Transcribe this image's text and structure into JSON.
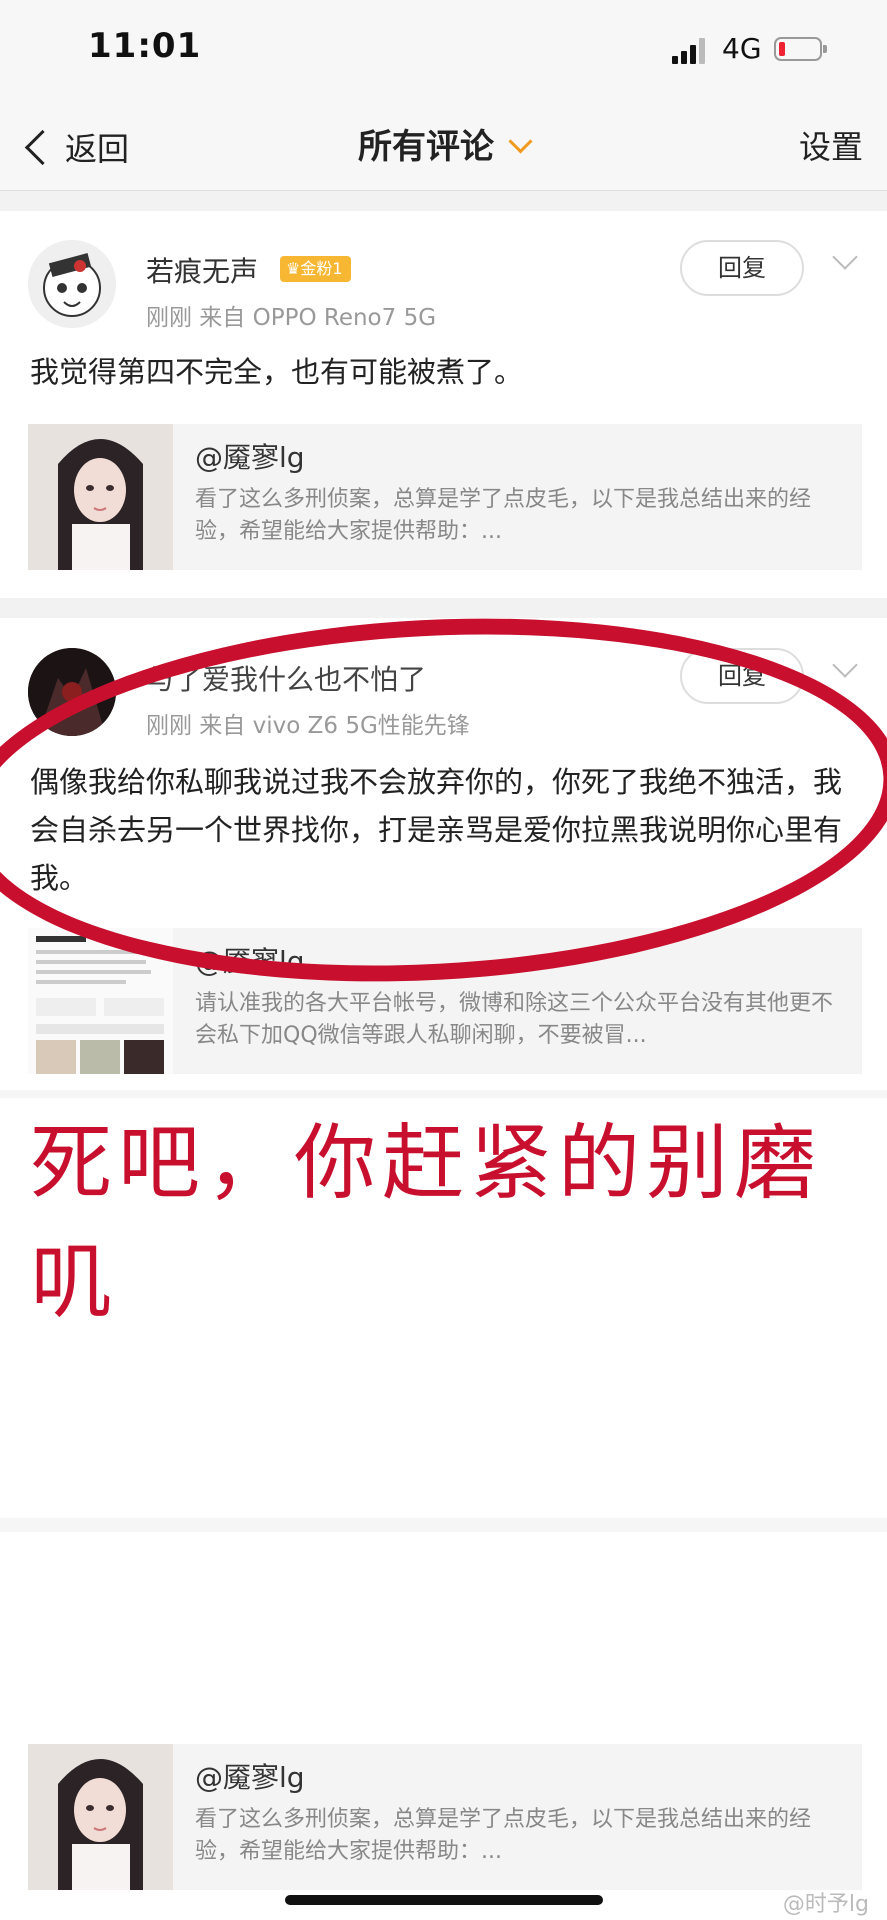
{
  "status": {
    "time": "11:01",
    "network": "4G"
  },
  "nav": {
    "back": "返回",
    "title": "所有评论",
    "settings": "设置"
  },
  "comments": [
    {
      "username": "若痕无声",
      "badge": "金粉1",
      "meta": "刚刚  来自 OPPO Reno7 5G",
      "reply": "回复",
      "text": "我觉得第四不完全，也有可能被煮了。",
      "card": {
        "title": "@魇寥lg",
        "desc": "看了这么多刑侦案，总算是学了点皮毛，以下是我总结出来的经验，希望能给大家提供帮助：..."
      }
    },
    {
      "username": "与了爱我什么也不怕了",
      "meta": "刚刚  来自 vivo Z6 5G性能先锋",
      "reply": "回复",
      "text": "偶像我给你私聊我说过我不会放弃你的，你死了我绝不独活，我会自杀去另一个世界找你，打是亲骂是爱你拉黑我说明你心里有我。",
      "card": {
        "title": "@魇寥lg",
        "desc": "请认准我的各大平台帐号，微博和除这三个公众平台没有其他更不会私下加QQ微信等跟人私聊闲聊，不要被冒..."
      }
    }
  ],
  "annotation": "死吧，你赶紧的别磨叽",
  "bottom_card": {
    "title": "@魇寥lg",
    "desc": "看了这么多刑侦案，总算是学了点皮毛，以下是我总结出来的经验，希望能给大家提供帮助：..."
  },
  "watermark": "@时予lg",
  "colors": {
    "accent": "#f29a1f",
    "annotation_red": "#c8102e",
    "badge": "#f7b732"
  }
}
